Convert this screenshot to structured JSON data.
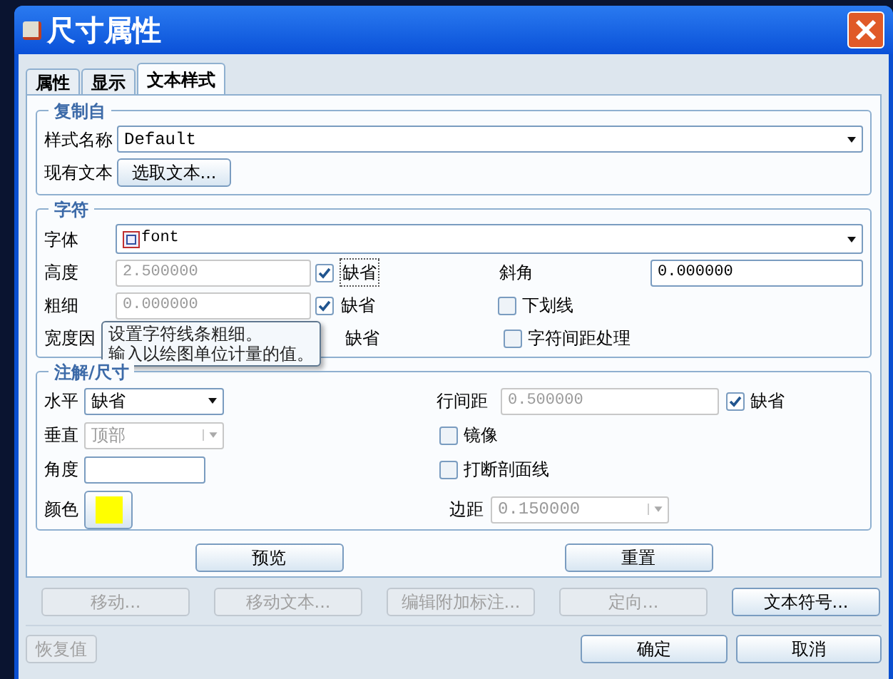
{
  "window": {
    "title": "尺寸属性"
  },
  "tabs": [
    {
      "label": "属性",
      "selected": false
    },
    {
      "label": "显示",
      "selected": false
    },
    {
      "label": "文本样式",
      "selected": true
    }
  ],
  "copy_from": {
    "title": "复制自",
    "style_label": "样式名称",
    "style_value": "Default",
    "existing_label": "现有文本",
    "select_button": "选取文本..."
  },
  "character": {
    "title": "字符",
    "font_label": "字体",
    "font_value": "font",
    "height": {
      "label": "高度",
      "value": "2.500000",
      "disabled": true,
      "checked": true,
      "check_label": "缺省"
    },
    "slant": {
      "label": "斜角",
      "value": "0.000000"
    },
    "thickness": {
      "label": "粗细",
      "value": "0.000000",
      "disabled": true,
      "checked": true,
      "check_label": "缺省"
    },
    "underline": {
      "label": "下划线",
      "checked": false
    },
    "width_factor": {
      "label": "宽度因",
      "check_label": "缺省"
    },
    "kerning": {
      "label": "字符间距处理",
      "checked": false
    },
    "tooltip": [
      "设置字符线条粗细。",
      "输入以绘图单位计量的值。"
    ]
  },
  "note": {
    "title": "注解/尺寸",
    "horizontal": {
      "label": "水平",
      "value": "缺省",
      "disabled": false
    },
    "vertical": {
      "label": "垂直",
      "value": "顶部",
      "disabled": true
    },
    "angle": {
      "label": "角度"
    },
    "color": {
      "label": "颜色",
      "color": "#ffff00"
    },
    "line_spacing": {
      "label": "行间距",
      "value": "0.500000",
      "disabled": true,
      "checked": true,
      "check_label": "缺省"
    },
    "mirror": {
      "label": "镜像",
      "checked": false
    },
    "break_hatch": {
      "label": "打断剖面线",
      "checked": false
    },
    "margin": {
      "label": "边距",
      "value": "0.150000",
      "disabled": true
    }
  },
  "panel_buttons": [
    "预览",
    "重置"
  ],
  "action_buttons": [
    {
      "label": "移动...",
      "disabled": true
    },
    {
      "label": "移动文本...",
      "disabled": true
    },
    {
      "label": "编辑附加标注...",
      "disabled": true
    },
    {
      "label": "定向...",
      "disabled": true
    },
    {
      "label": "文本符号...",
      "disabled": false
    }
  ],
  "footer": {
    "restore": {
      "label": "恢复值",
      "disabled": true
    },
    "ok": "确定",
    "cancel": "取消"
  }
}
